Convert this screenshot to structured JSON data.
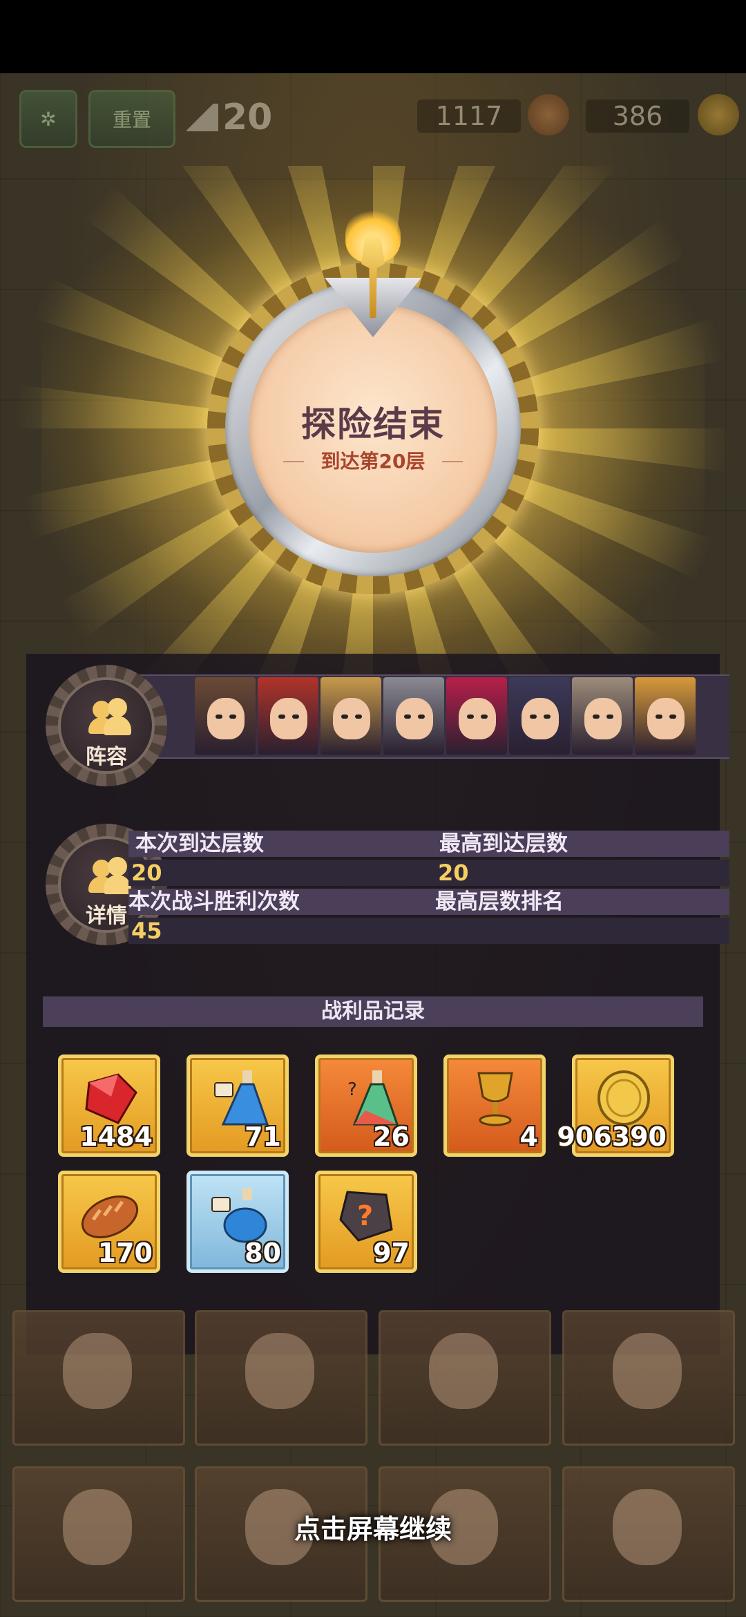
{
  "hud": {
    "reset_label": "重置",
    "floor": "20",
    "resource1": "1117",
    "resource2": "386"
  },
  "medal": {
    "title": "探险结束",
    "subtitle": "到达第20层"
  },
  "lineup": {
    "label": "阵容",
    "heroes": [
      {
        "name": "hero-1",
        "color": "#6b4a34"
      },
      {
        "name": "hero-2",
        "color": "#b0342a"
      },
      {
        "name": "hero-3",
        "color": "#c79a4a"
      },
      {
        "name": "hero-4",
        "color": "#8a8a92"
      },
      {
        "name": "hero-5",
        "color": "#b81f4a"
      },
      {
        "name": "hero-6",
        "color": "#3c3a5a"
      },
      {
        "name": "hero-7",
        "color": "#9c8c7a"
      },
      {
        "name": "hero-8",
        "color": "#d79a3a"
      }
    ]
  },
  "details": {
    "label": "详情",
    "current_floor_label": "本次到达层数",
    "current_floor_value": "20",
    "best_floor_label": "最高到达层数",
    "best_floor_value": "20",
    "wins_label": "本次战斗胜利次数",
    "wins_value": "45",
    "rank_label": "最高层数排名"
  },
  "loot": {
    "title": "战利品记录",
    "items": [
      {
        "icon": "gem-icon",
        "count": "1484",
        "frame": "gold"
      },
      {
        "icon": "potion-icon",
        "count": "71",
        "frame": "gold"
      },
      {
        "icon": "mystery-potion-icon",
        "count": "26",
        "frame": "orange"
      },
      {
        "icon": "chalice-icon",
        "count": "4",
        "frame": "orange"
      },
      {
        "icon": "gold-coin-icon",
        "count": "906390",
        "frame": "gold"
      },
      {
        "icon": "bread-icon",
        "count": "170",
        "frame": "gold"
      },
      {
        "icon": "blue-potion-icon",
        "count": "80",
        "frame": "blue"
      },
      {
        "icon": "mystery-stone-icon",
        "count": "97",
        "frame": "gold"
      }
    ]
  },
  "continue_hint": "点击屏幕继续"
}
